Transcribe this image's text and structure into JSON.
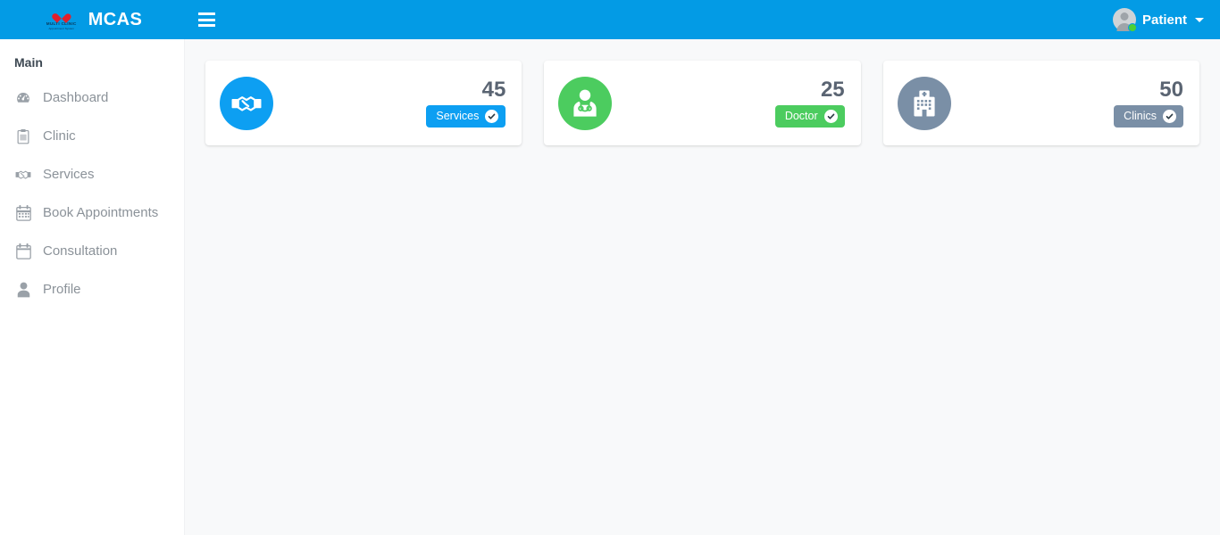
{
  "topbar": {
    "brand_name": "MCAS",
    "logo_line1": "MULTI CLINIC",
    "logo_line2": "Appointment System",
    "background_color": "#039BE5",
    "menu_toggle_label": "Toggle navigation",
    "user_name": "Patient",
    "user_status_color": "#4cd137"
  },
  "sidebar": {
    "heading": "Main",
    "items": [
      {
        "label": "Dashboard",
        "icon": "tachometer-icon"
      },
      {
        "label": "Clinic",
        "icon": "clipboard-icon"
      },
      {
        "label": "Services",
        "icon": "handshake-icon"
      },
      {
        "label": "Book Appointments",
        "icon": "calendar-grid-icon"
      },
      {
        "label": "Consultation",
        "icon": "calendar-icon"
      },
      {
        "label": "Profile",
        "icon": "user-icon"
      }
    ]
  },
  "main": {
    "cards": [
      {
        "count": "45",
        "badge_label": "Services",
        "icon": "handshake-icon",
        "color": "#0D9FF2",
        "badge_color": "#0D9FF2"
      },
      {
        "count": "25",
        "badge_label": "Doctor",
        "icon": "doctor-icon",
        "color": "#4CCC5F",
        "badge_color": "#4CCC5F"
      },
      {
        "count": "50",
        "badge_label": "Clinics",
        "icon": "hospital-icon",
        "color": "#7A8FA6",
        "badge_color": "#7A8FA6"
      }
    ]
  }
}
